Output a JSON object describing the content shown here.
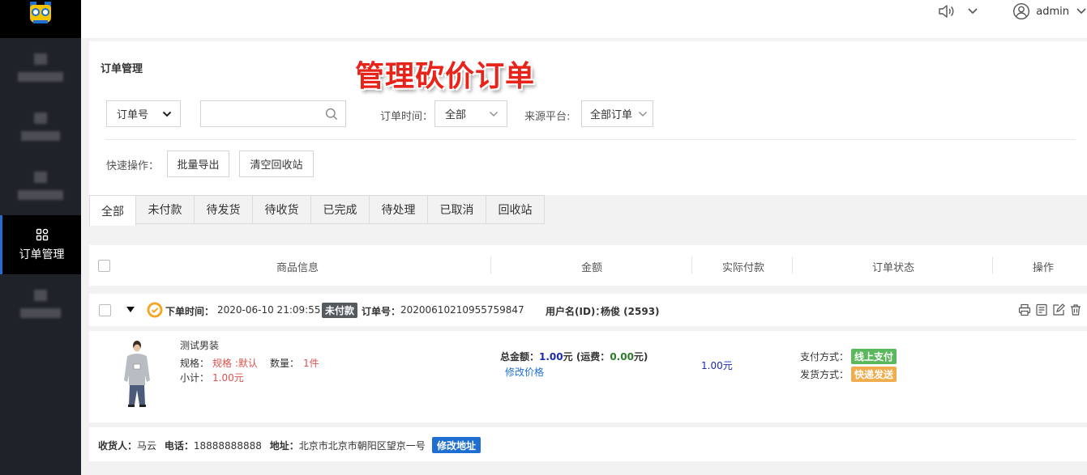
{
  "sidebar": {
    "active_item": {
      "label": "订单管理",
      "icon": "grid-icon"
    }
  },
  "topbar": {
    "user": {
      "name": "admin"
    }
  },
  "page": {
    "title": "订单管理",
    "banner": "管理砍价订单"
  },
  "filters": {
    "search_type": "订单号",
    "search_placeholder": "",
    "order_time_label": "订单时间：",
    "order_time_value": "全部",
    "source_label": "来源平台:",
    "source_value": "全部订单"
  },
  "quick_ops": {
    "label": "快速操作：",
    "export_label": "批量导出",
    "clear_label": "清空回收站"
  },
  "tabs": [
    {
      "label": "全部"
    },
    {
      "label": "未付款"
    },
    {
      "label": "待发货"
    },
    {
      "label": "待收货"
    },
    {
      "label": "已完成"
    },
    {
      "label": "待处理"
    },
    {
      "label": "已取消"
    },
    {
      "label": "回收站"
    }
  ],
  "table": {
    "headers": [
      "商品信息",
      "金额",
      "实际付款",
      "订单状态",
      "操作"
    ]
  },
  "order": {
    "time_label": "下单时间：",
    "time": "2020-06-10 21:09:55",
    "status_tag": "未付款",
    "no_label": "订单号：",
    "no": "20200610210955759847",
    "user_label": "用户名(ID)：",
    "user": "杨俊 (2593)",
    "product": {
      "name": "测试男装",
      "spec_label": "规格：",
      "spec": "规格 :默认",
      "qty_label": "数量：",
      "qty": "1件",
      "subtotal_label": "小计：",
      "subtotal": "1.00元"
    },
    "amount": {
      "total_label": "总金额：",
      "total": "1.00",
      "unit": "元",
      "freight_label": " (运费：",
      "freight": "0.00",
      "freight_unit": "元)",
      "edit_price": "修改价格"
    },
    "actual_paid": "1.00元",
    "status": {
      "pay_label": "支付方式：",
      "pay_method": "线上支付",
      "ship_label": "发货方式：",
      "ship_method": "快递发送",
      "pay_color": "#5cb85c",
      "ship_color": "#f0ad4e"
    },
    "receiver": {
      "name_label": "收货人：",
      "name": "马云",
      "phone_label": "电话：",
      "phone": "18888888888",
      "addr_label": "地址：",
      "addr": "北京市北京市朝阳区望京一号",
      "edit_label": "修改地址"
    }
  }
}
